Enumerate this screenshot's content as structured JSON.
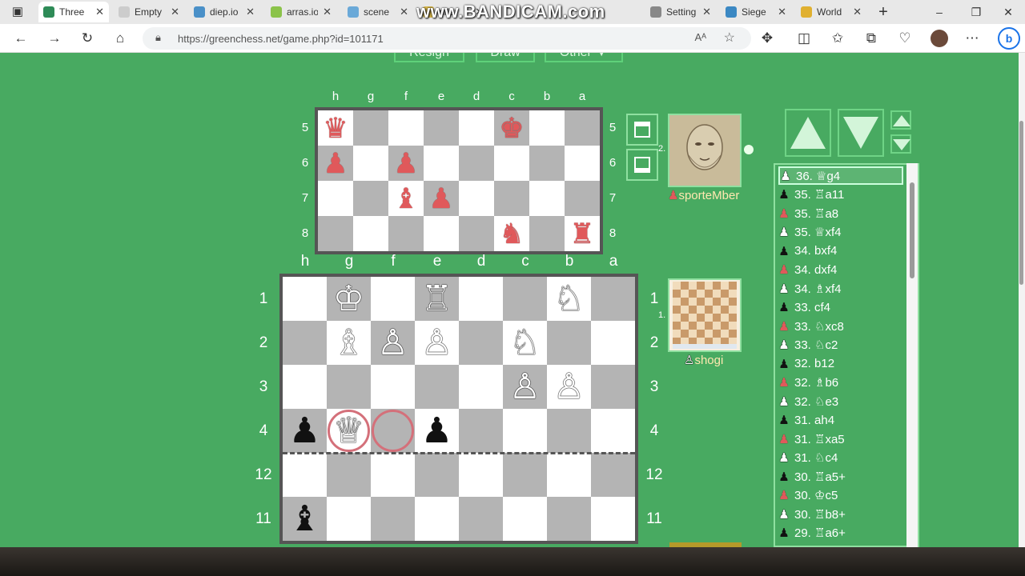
{
  "browser": {
    "tabs": [
      {
        "title": "Three",
        "color": "#2e8b57",
        "active": true
      },
      {
        "title": "Empty",
        "color": "#cccccc"
      },
      {
        "title": "diep.io",
        "color": "#4a90c8"
      },
      {
        "title": "arras.io",
        "color": "#8bc34a"
      },
      {
        "title": "scene",
        "color": "#6aa9d8"
      },
      {
        "title": "nifor",
        "color": "#d9b84a"
      },
      {
        "title": "Setting",
        "color": "#888888"
      },
      {
        "title": "Siege",
        "color": "#3b88c3"
      },
      {
        "title": "World",
        "color": "#e0b030"
      }
    ],
    "watermark": "www.BANDICAM.com",
    "url": "https://greenchess.net/game.php?id=101171",
    "new_tab": "+",
    "window_controls": [
      "–",
      "❐",
      "✕"
    ]
  },
  "game": {
    "buttons": {
      "resign": "Resign",
      "draw": "Draw",
      "other": "Other ▼"
    },
    "small_board": {
      "files": [
        "h",
        "g",
        "f",
        "e",
        "d",
        "c",
        "b",
        "a"
      ],
      "ranks": [
        "5",
        "6",
        "7",
        "8"
      ],
      "pieces": [
        {
          "sq": "h5",
          "glyph": "♛",
          "side": "red"
        },
        {
          "sq": "c5",
          "glyph": "♚",
          "side": "red"
        },
        {
          "sq": "h6",
          "glyph": "♟",
          "side": "red"
        },
        {
          "sq": "f6",
          "glyph": "♟",
          "side": "red"
        },
        {
          "sq": "f7",
          "glyph": "♝",
          "side": "red"
        },
        {
          "sq": "e7",
          "glyph": "♟",
          "side": "red"
        },
        {
          "sq": "c8",
          "glyph": "♞",
          "side": "red"
        },
        {
          "sq": "a8",
          "glyph": "♜",
          "side": "red"
        }
      ]
    },
    "main_board": {
      "files": [
        "h",
        "g",
        "f",
        "e",
        "d",
        "c",
        "b",
        "a"
      ],
      "ranks": [
        "1",
        "2",
        "3",
        "4",
        "12",
        "11"
      ],
      "pieces": [
        {
          "sq": "g1",
          "glyph": "♔",
          "side": "white"
        },
        {
          "sq": "e1",
          "glyph": "♖",
          "side": "white"
        },
        {
          "sq": "b1",
          "glyph": "♘",
          "side": "white"
        },
        {
          "sq": "g2",
          "glyph": "♗",
          "side": "white"
        },
        {
          "sq": "f2",
          "glyph": "♙",
          "side": "white"
        },
        {
          "sq": "e2",
          "glyph": "♙",
          "side": "white"
        },
        {
          "sq": "c2",
          "glyph": "♘",
          "side": "white"
        },
        {
          "sq": "c3",
          "glyph": "♙",
          "side": "white"
        },
        {
          "sq": "b3",
          "glyph": "♙",
          "side": "white"
        },
        {
          "sq": "h4",
          "glyph": "♟",
          "side": "black"
        },
        {
          "sq": "g4",
          "glyph": "♕",
          "side": "white"
        },
        {
          "sq": "e4",
          "glyph": "♟",
          "side": "black"
        },
        {
          "sq": "h11",
          "glyph": "♝",
          "side": "black"
        }
      ],
      "highlights": [
        "g4",
        "f4"
      ]
    },
    "players": [
      {
        "name": "sporteMber",
        "seat": "2.",
        "icon": "♟"
      },
      {
        "name": "shogi",
        "seat": "1.",
        "icon": "♙"
      }
    ],
    "moves": [
      {
        "side": "white",
        "text": "36. ♕g4",
        "selected": true
      },
      {
        "side": "black",
        "text": "35. ♖a11"
      },
      {
        "side": "red",
        "text": "35. ♖a8"
      },
      {
        "side": "white",
        "text": "35. ♕xf4"
      },
      {
        "side": "black",
        "text": "34. bxf4"
      },
      {
        "side": "red",
        "text": "34. dxf4"
      },
      {
        "side": "white",
        "text": "34. ♗xf4"
      },
      {
        "side": "black",
        "text": "33. cf4"
      },
      {
        "side": "red",
        "text": "33. ♘xc8"
      },
      {
        "side": "white",
        "text": "33. ♘c2"
      },
      {
        "side": "black",
        "text": "32. b12"
      },
      {
        "side": "red",
        "text": "32. ♗b6"
      },
      {
        "side": "white",
        "text": "32. ♘e3"
      },
      {
        "side": "black",
        "text": "31. ah4"
      },
      {
        "side": "red",
        "text": "31. ♖xa5"
      },
      {
        "side": "white",
        "text": "31. ♘c4"
      },
      {
        "side": "black",
        "text": "30. ♖a5+"
      },
      {
        "side": "red",
        "text": "30. ♔c5"
      },
      {
        "side": "white",
        "text": "30. ♖b8+"
      },
      {
        "side": "black",
        "text": "29. ♖a6+"
      }
    ],
    "colors": {
      "page_bg": "#48aa61",
      "light_sq": "#ffffff",
      "dark_sq": "#b4b4b4",
      "red_piece": "#e0595b"
    }
  }
}
